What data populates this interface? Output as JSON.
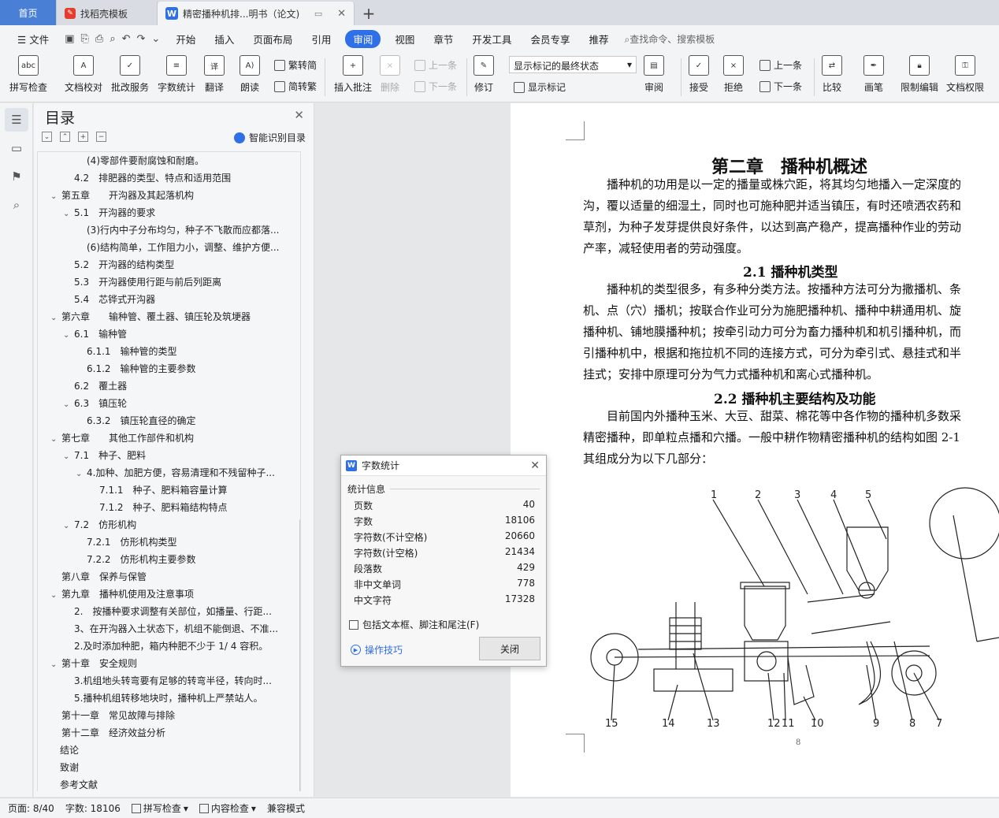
{
  "tabs": [
    {
      "label": "首页"
    },
    {
      "label": "找稻壳模板"
    },
    {
      "label": "精密播种机排...明书（论文)"
    }
  ],
  "menu": [
    "文件",
    "开始",
    "插入",
    "页面布局",
    "引用",
    "审阅",
    "视图",
    "章节",
    "开发工具",
    "会员专享",
    "推荐"
  ],
  "menu_active": "审阅",
  "search_placeholder": "查找命令、搜索模板",
  "ribbon": {
    "spell": "拼写检查",
    "proofread": "文档校对",
    "annotate_service": "批改服务",
    "word_count": "字数统计",
    "translate": "翻译",
    "read_aloud": "朗读",
    "to_traditional": "繁转简",
    "to_simplified": "简转繁",
    "insert_comment": "插入批注",
    "delete": "删除",
    "prev_comment": "上一条",
    "next_comment": "下一条",
    "track": "修订",
    "markup_state": "显示标记的最终状态",
    "show_markup": "显示标记",
    "review": "审阅",
    "accept": "接受",
    "reject": "拒绝",
    "prev_change": "上一条",
    "next_change": "下一条",
    "compare": "比较",
    "pen": "画笔",
    "restrict": "限制编辑",
    "permission": "文档权限"
  },
  "toc": {
    "title": "目录",
    "smart_label": "智能识别目录",
    "items": [
      {
        "text": "(4)零部件要耐腐蚀和耐磨。",
        "level": 3,
        "caret": ""
      },
      {
        "text": "4.2　排肥器的类型、特点和适用范围",
        "level": 2,
        "caret": ""
      },
      {
        "text": "第五章　　开沟器及其起落机构",
        "level": 1,
        "caret": "v"
      },
      {
        "text": "5.1　开沟器的要求",
        "level": 2,
        "caret": "v"
      },
      {
        "text": "(3)行内中子分布均匀，种子不飞散而应都落...",
        "level": 3,
        "caret": ""
      },
      {
        "text": "(6)结构简单，工作阻力小，调整、维护方便...",
        "level": 3,
        "caret": ""
      },
      {
        "text": "5.2　开沟器的结构类型",
        "level": 2,
        "caret": ""
      },
      {
        "text": "5.3　开沟器使用行距与前后列距离",
        "level": 2,
        "caret": ""
      },
      {
        "text": "5.4　芯铧式开沟器",
        "level": 2,
        "caret": ""
      },
      {
        "text": "第六章　　输种管、覆土器、镇压轮及筑埂器",
        "level": 1,
        "caret": "v"
      },
      {
        "text": "6.1　输种管",
        "level": 2,
        "caret": "v"
      },
      {
        "text": "6.1.1　输种管的类型",
        "level": 3,
        "caret": ""
      },
      {
        "text": "6.1.2　输种管的主要参数",
        "level": 3,
        "caret": ""
      },
      {
        "text": "6.2　覆土器",
        "level": 2,
        "caret": ""
      },
      {
        "text": "6.3　镇压轮",
        "level": 2,
        "caret": "v"
      },
      {
        "text": "6.3.2　镇压轮直径的确定",
        "level": 3,
        "caret": ""
      },
      {
        "text": "第七章　　其他工作部件和机构",
        "level": 1,
        "caret": "v"
      },
      {
        "text": "7.1　种子、肥料",
        "level": 2,
        "caret": "v"
      },
      {
        "text": "4.加种、加肥方便，容易清理和不残留种子...",
        "level": 3,
        "caret": "v"
      },
      {
        "text": "7.1.1　种子、肥料箱容量计算",
        "level": 4,
        "caret": ""
      },
      {
        "text": "7.1.2　种子、肥料箱结构特点",
        "level": 4,
        "caret": ""
      },
      {
        "text": "7.2　仿形机构",
        "level": 2,
        "caret": "v"
      },
      {
        "text": "7.2.1　仿形机构类型",
        "level": 3,
        "caret": ""
      },
      {
        "text": "7.2.2　仿形机构主要参数",
        "level": 3,
        "caret": ""
      },
      {
        "text": "第八章　保养与保管",
        "level": 1,
        "caret": ""
      },
      {
        "text": "第九章　播种机使用及注意事项",
        "level": 1,
        "caret": "v"
      },
      {
        "text": "2.　按播种要求调整有关部位，如播量、行距...",
        "level": 2,
        "caret": ""
      },
      {
        "text": "3、在开沟器入土状态下，机组不能倒退、不准...",
        "level": 2,
        "caret": ""
      },
      {
        "text": "2.及时添加种肥，箱内种肥不少于 1/ 4 容积。",
        "level": 2,
        "caret": ""
      },
      {
        "text": "第十章　安全规则",
        "level": 1,
        "caret": "v"
      },
      {
        "text": "3.机组地头转弯要有足够的转弯半径，转向时...",
        "level": 2,
        "caret": ""
      },
      {
        "text": "5.播种机组转移地块时，播种机上严禁站人。",
        "level": 2,
        "caret": ""
      },
      {
        "text": "第十一章　常见故障与排除",
        "level": 1,
        "caret": ""
      },
      {
        "text": "第十二章　经济效益分析",
        "level": 1,
        "caret": ""
      },
      {
        "text": "结论",
        "level": 0,
        "caret": ""
      },
      {
        "text": "致谢",
        "level": 0,
        "caret": ""
      },
      {
        "text": "参考文献",
        "level": 0,
        "caret": ""
      }
    ]
  },
  "document": {
    "chapter_title": "第二章　播种机概述",
    "para1": [
      "　　播种机的功用是以一定的播量或株穴距，将其均匀地播入一定深度的",
      "沟，覆以适量的细湿土，同时也可施种肥并适当镇压，有时还喷洒农药和",
      "草剂，为种子发芽提供良好条件，以达到高产稳产，提高播种作业的劳动",
      "产率，减轻使用者的劳动强度。"
    ],
    "sec1": "2.1  播种机类型",
    "para2": [
      "　　播种机的类型很多，有多种分类方法。按播种方法可分为撒播机、条",
      "机、点（穴）播机；按联合作业可分为施肥播种机、播种中耕通用机、旋",
      "播种机、铺地膜播种机；按牵引动力可分为畜力播种机和机引播种机，而",
      "引播种机中，根据和拖拉机不同的连接方式，可分为牵引式、悬挂式和半",
      "挂式；安排中原理可分为气力式播种机和离心式播种机。"
    ],
    "sec2": "2.2  播种机主要结构及功能",
    "para3": [
      "　　目前国内外播种玉米、大豆、甜菜、棉花等中各作物的播种机多数采",
      "精密播种，即单粒点播和穴播。一般中耕作物精密播种机的结构如图 2-1",
      "其组成分为以下几部分："
    ],
    "figure_numbers": [
      "1",
      "2",
      "3",
      "4",
      "5",
      "15",
      "14",
      "13",
      "12",
      "11",
      "10",
      "9",
      "8",
      "7"
    ],
    "page_number": "8"
  },
  "dialog": {
    "title": "字数统计",
    "section": "统计信息",
    "stats": [
      {
        "label": "页数",
        "value": "40"
      },
      {
        "label": "字数",
        "value": "18106"
      },
      {
        "label": "字符数(不计空格)",
        "value": "20660"
      },
      {
        "label": "字符数(计空格)",
        "value": "21434"
      },
      {
        "label": "段落数",
        "value": "429"
      },
      {
        "label": "非中文单词",
        "value": "778"
      },
      {
        "label": "中文字符",
        "value": "17328"
      }
    ],
    "checkbox_label": "包括文本框、脚注和尾注(F)",
    "tips_label": "操作技巧",
    "close_label": "关闭"
  },
  "status": {
    "page": "页面: 8/40",
    "words": "字数: 18106",
    "spell": "拼写检查",
    "content_check": "内容检查",
    "compat": "兼容模式"
  }
}
